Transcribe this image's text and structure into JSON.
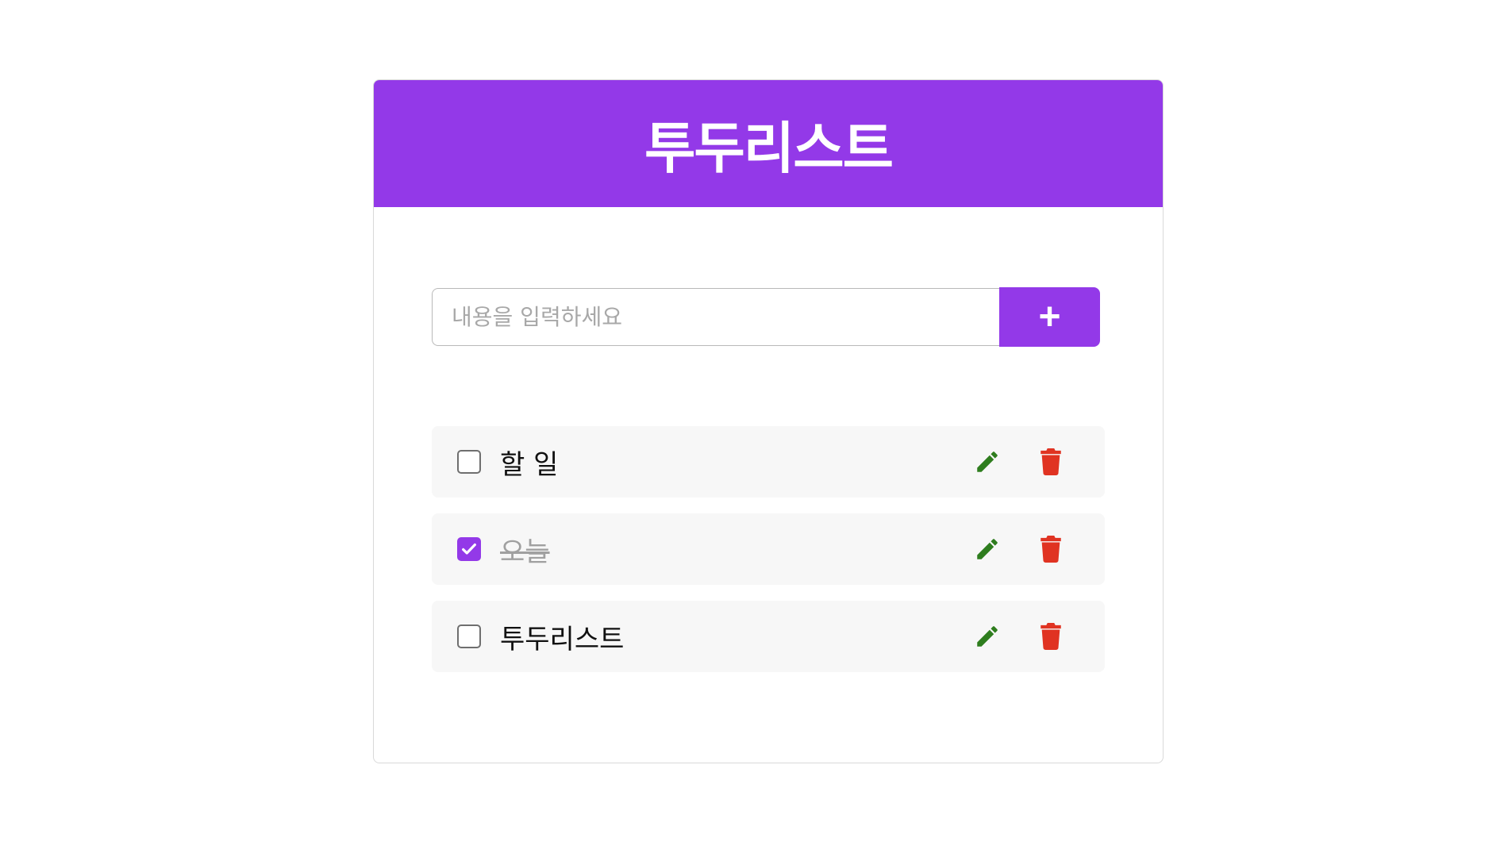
{
  "app": {
    "title": "투두리스트"
  },
  "input": {
    "placeholder": "내용을 입력하세요",
    "value": "",
    "add_button_label": "+"
  },
  "todos": [
    {
      "text": "할 일",
      "done": false
    },
    {
      "text": "오늘",
      "done": true
    },
    {
      "text": "투두리스트",
      "done": false
    }
  ],
  "colors": {
    "accent": "#9339e8",
    "edit_icon": "#2e7d1e",
    "delete_icon": "#e03322"
  },
  "icons": {
    "edit": "pencil-icon",
    "delete": "trash-icon",
    "check": "check-icon"
  }
}
